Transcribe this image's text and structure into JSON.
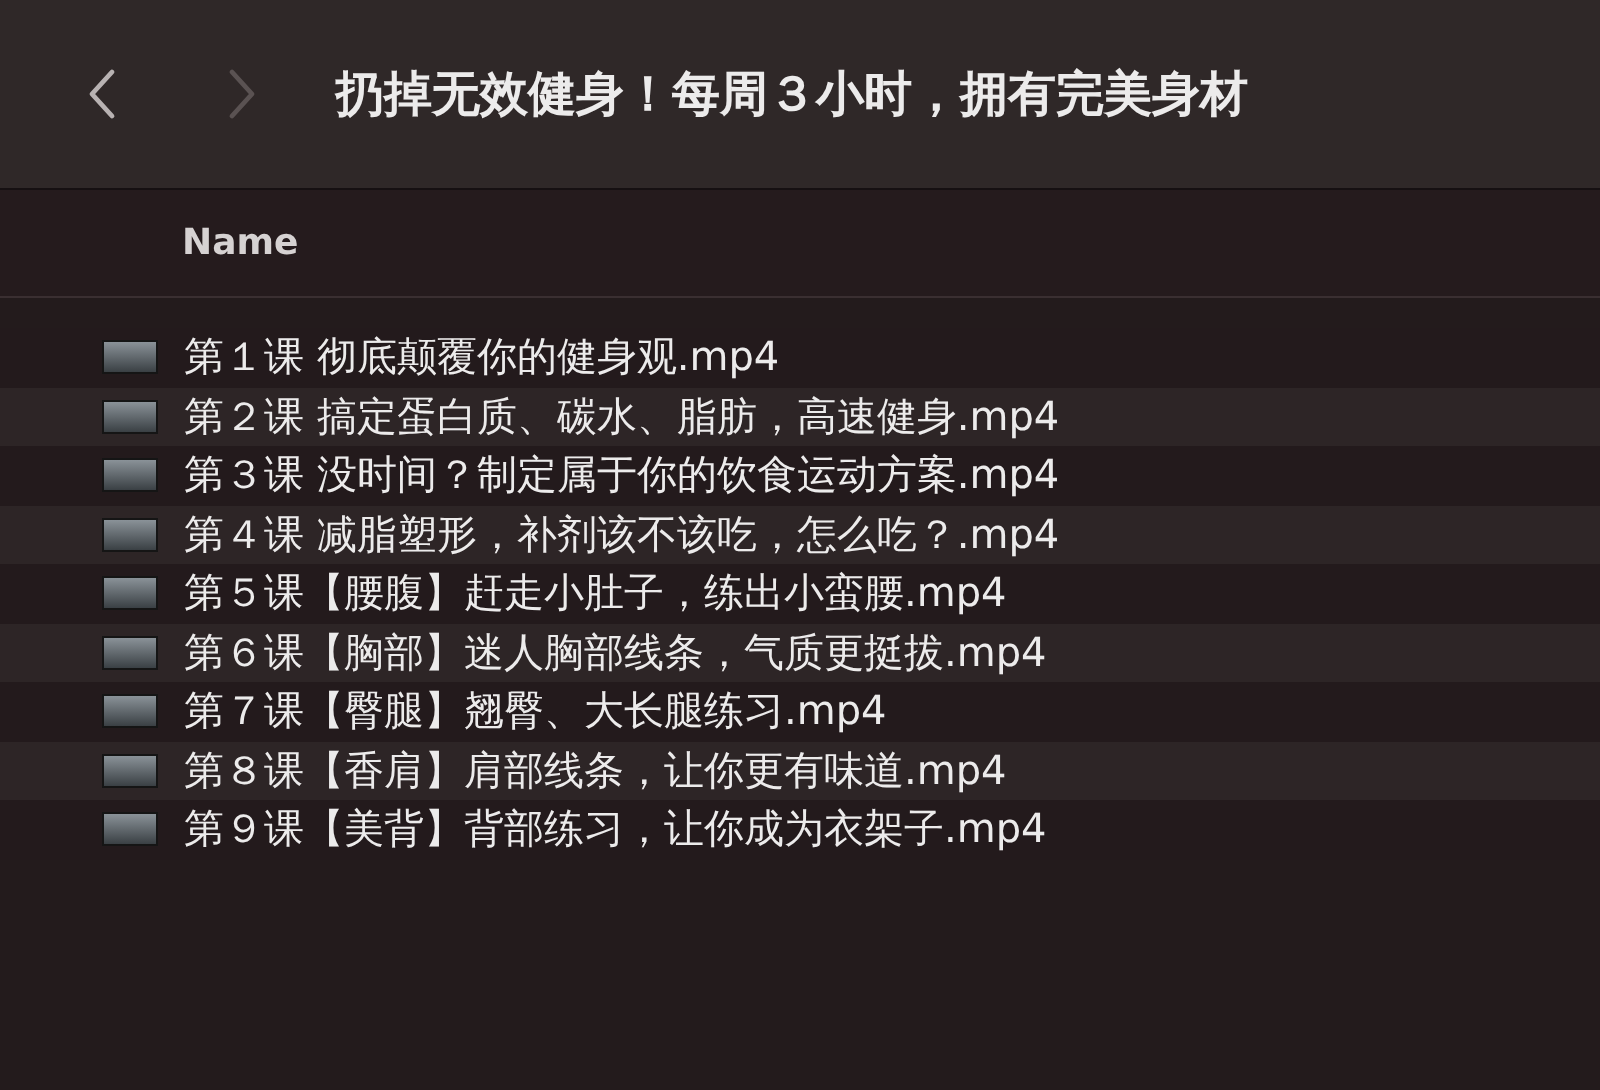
{
  "toolbar": {
    "back": {
      "disabled": false
    },
    "forward": {
      "disabled": true
    },
    "title": "扔掉无效健身！每周３小时，拥有完美身材"
  },
  "table": {
    "columns": [
      "Name"
    ],
    "rows": [
      {
        "name": "第１课 彻底颠覆你的健身观.mp4"
      },
      {
        "name": "第２课 搞定蛋白质、碳水、脂肪，高速健身.mp4"
      },
      {
        "name": "第３课 没时间？制定属于你的饮食运动方案.mp4"
      },
      {
        "name": "第４课 减脂塑形，补剂该不该吃，怎么吃？.mp4"
      },
      {
        "name": "第５课【腰腹】赶走小肚子，练出小蛮腰.mp4"
      },
      {
        "name": "第６课【胸部】迷人胸部线条，气质更挺拔.mp4"
      },
      {
        "name": "第７课【臀腿】翘臀、大长腿练习.mp4"
      },
      {
        "name": "第８课【香肩】肩部线条，让你更有味道.mp4"
      },
      {
        "name": "第９课【美背】背部练习，让你成为衣架子.mp4"
      }
    ]
  }
}
